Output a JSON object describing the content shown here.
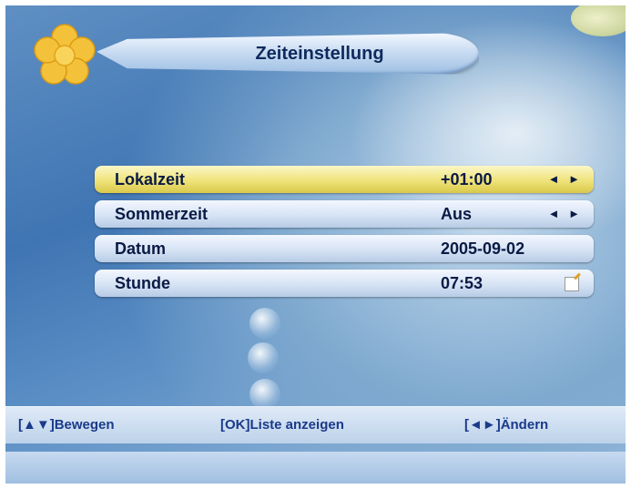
{
  "header": {
    "title": "Zeiteinstellung",
    "logo_icon": "flower-icon"
  },
  "menu": {
    "items": [
      {
        "label": "Lokalzeit",
        "value": "+01:00",
        "control": "◄ ►",
        "active": true
      },
      {
        "label": "Sommerzeit",
        "value": "Aus",
        "control": "◄ ►",
        "active": false
      },
      {
        "label": "Datum",
        "value": "2005-09-02",
        "control": "",
        "active": false
      },
      {
        "label": "Stunde",
        "value": "07:53",
        "control": "edit-icon",
        "active": false
      }
    ]
  },
  "footer": {
    "move_key": "[▲▼]",
    "move_label": "Bewegen",
    "ok_key": "[OK]",
    "ok_label": "Liste anzeigen",
    "change_key": "[◄►]",
    "change_label": "Ändern"
  },
  "colors": {
    "active_row": "#efe37a",
    "row": "#d6e3f4",
    "text": "#0a1a44",
    "footer_text": "#1a3a8a"
  }
}
